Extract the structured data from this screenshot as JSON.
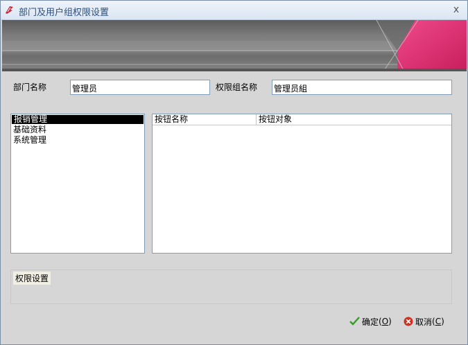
{
  "window": {
    "title": "部门及用户组权限设置",
    "close_glyph": "x",
    "icon": "app-logo-icon"
  },
  "form": {
    "department_label": "部门名称",
    "department_value": "管理员",
    "permission_group_label": "权限组名称",
    "permission_group_value": "管理员組"
  },
  "module_list": {
    "items": [
      {
        "label": "报销管理",
        "selected": true
      },
      {
        "label": "基础资料",
        "selected": false
      },
      {
        "label": "系统管理",
        "selected": false
      }
    ]
  },
  "button_grid": {
    "columns": [
      "按钮名称",
      "按钮对象"
    ],
    "rows": []
  },
  "permission_group_box": {
    "title": "权限设置"
  },
  "actions": {
    "ok_label": "确定",
    "ok_accel": "O",
    "cancel_label": "取消",
    "cancel_accel": "C"
  },
  "colors": {
    "banner_accent": "#e8307a",
    "ok_icon": "#3a9a28",
    "cancel_icon": "#d03020"
  }
}
